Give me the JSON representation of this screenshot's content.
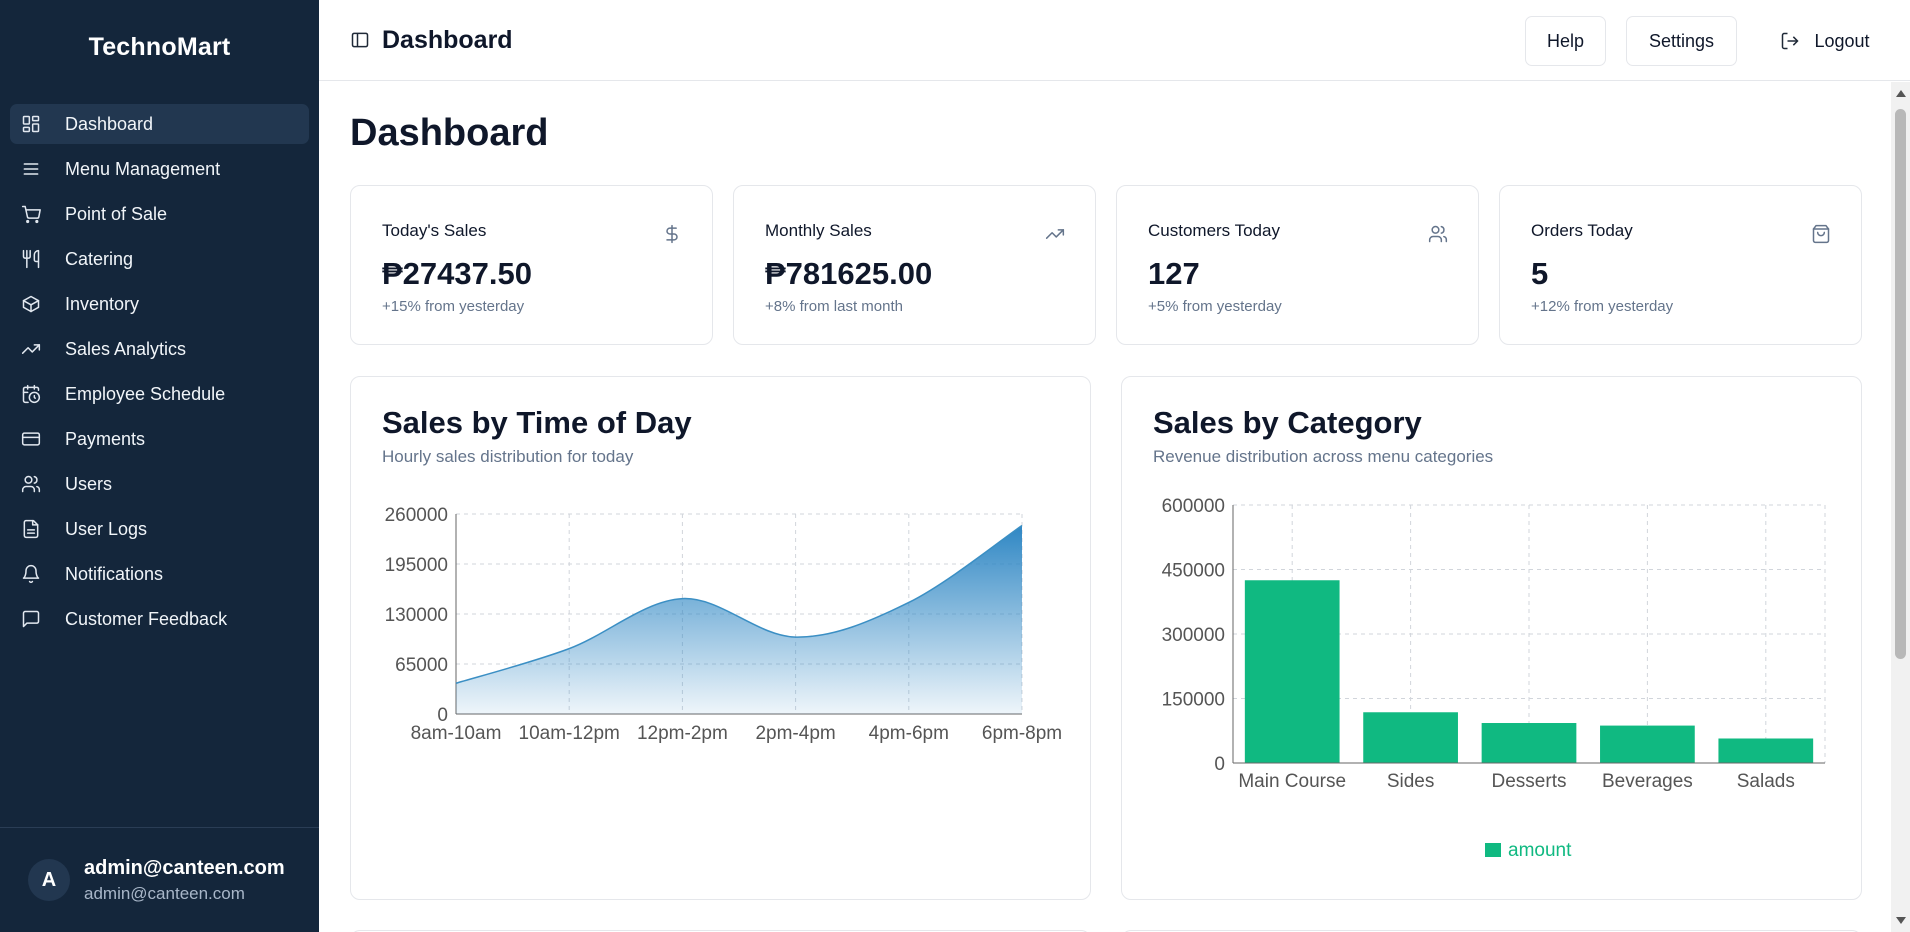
{
  "app": {
    "brand": "TechnoMart"
  },
  "sidebar": {
    "items": [
      {
        "label": "Dashboard",
        "icon": "dashboard-icon",
        "active": true
      },
      {
        "label": "Menu Management",
        "icon": "menu-lines-icon"
      },
      {
        "label": "Point of Sale",
        "icon": "cart-icon"
      },
      {
        "label": "Catering",
        "icon": "utensils-icon"
      },
      {
        "label": "Inventory",
        "icon": "package-icon"
      },
      {
        "label": "Sales Analytics",
        "icon": "trending-up-icon"
      },
      {
        "label": "Employee Schedule",
        "icon": "calendar-clock-icon"
      },
      {
        "label": "Payments",
        "icon": "credit-card-icon"
      },
      {
        "label": "Users",
        "icon": "users-icon"
      },
      {
        "label": "User Logs",
        "icon": "file-text-icon"
      },
      {
        "label": "Notifications",
        "icon": "bell-icon"
      },
      {
        "label": "Customer Feedback",
        "icon": "message-square-icon"
      }
    ],
    "user": {
      "initial": "A",
      "name": "admin@canteen.com",
      "email": "admin@canteen.com"
    }
  },
  "header": {
    "title": "Dashboard",
    "help_label": "Help",
    "settings_label": "Settings",
    "logout_label": "Logout"
  },
  "main": {
    "title": "Dashboard",
    "stats": [
      {
        "label": "Today's Sales",
        "value": "₱27437.50",
        "sub": "+15% from yesterday",
        "icon": "dollar-icon"
      },
      {
        "label": "Monthly Sales",
        "value": "₱781625.00",
        "sub": "+8% from last month",
        "icon": "trending-up-icon"
      },
      {
        "label": "Customers Today",
        "value": "127",
        "sub": "+5% from yesterday",
        "icon": "users-icon"
      },
      {
        "label": "Orders Today",
        "value": "5",
        "sub": "+12% from yesterday",
        "icon": "shopping-bag-icon"
      }
    ],
    "time_card": {
      "title": "Sales by Time of Day",
      "subtitle": "Hourly sales distribution for today"
    },
    "category_card": {
      "title": "Sales by Category",
      "subtitle": "Revenue distribution across menu categories"
    }
  },
  "colors": {
    "sidebar_bg": "#14263b",
    "area_stroke": "#3b8fc4",
    "bar_fill": "#10b981"
  },
  "chart_data": [
    {
      "type": "area",
      "title": "Sales by Time of Day",
      "categories": [
        "8am-10am",
        "10am-12pm",
        "12pm-2pm",
        "2pm-4pm",
        "4pm-6pm",
        "6pm-8pm"
      ],
      "values": [
        40000,
        85000,
        150000,
        100000,
        145000,
        245000
      ],
      "ylim": [
        0,
        260000
      ],
      "yticks": [
        "0",
        "65000",
        "130000",
        "195000",
        "260000"
      ],
      "grid": true
    },
    {
      "type": "bar",
      "title": "Sales by Category",
      "categories": [
        "Main Course",
        "Sides",
        "Desserts",
        "Beverages",
        "Salads"
      ],
      "series": [
        {
          "name": "amount",
          "values": [
            425000,
            118000,
            93000,
            87000,
            57000
          ]
        }
      ],
      "ylim": [
        0,
        600000
      ],
      "yticks": [
        "0",
        "150000",
        "300000",
        "450000",
        "600000"
      ],
      "legend": "bottom",
      "grid": true
    }
  ]
}
